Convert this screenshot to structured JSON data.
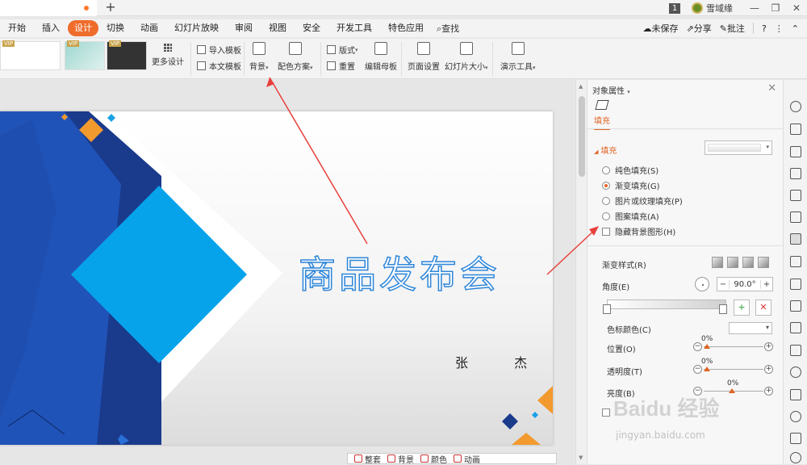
{
  "topbar": {
    "badge": "1",
    "username": "雪域缘"
  },
  "menu": {
    "tabs": [
      "开始",
      "插入",
      "设计",
      "切换",
      "动画",
      "幻灯片放映",
      "审阅",
      "视图",
      "安全",
      "开发工具",
      "特色应用"
    ],
    "active_index": 2,
    "search": "查找",
    "right": [
      "未保存",
      "分享",
      "批注"
    ]
  },
  "ribbon": {
    "more_design": "更多设计",
    "import_template": "导入模板",
    "this_template": "本文模板",
    "background": "背景",
    "color_scheme": "配色方案",
    "layout": "版式",
    "reset": "重置",
    "edit_master": "编辑母板",
    "page_setup": "页面设置",
    "slide_size": "幻灯片大小",
    "presentation_tools": "演示工具",
    "vip": "VIP"
  },
  "slide": {
    "title": "商品发布会",
    "subtitle": "张  杰"
  },
  "bottom_toolbar": [
    "整套",
    "背景",
    "颜色",
    "动画"
  ],
  "panel": {
    "title": "对象属性",
    "tab": "填充",
    "section": "填充",
    "fill_options": [
      {
        "label": "纯色填充(S)",
        "selected": false
      },
      {
        "label": "渐变填充(G)",
        "selected": true
      },
      {
        "label": "图片或纹理填充(P)",
        "selected": false
      },
      {
        "label": "图案填充(A)",
        "selected": false
      }
    ],
    "hide_bg_graphics": "隐藏背景图形(H)",
    "gradient_style": "渐变样式(R)",
    "angle_label": "角度(E)",
    "angle_value": "90.0°",
    "stop_color": "色标颜色(C)",
    "position_label": "位置(O)",
    "position_value": "0%",
    "transparency_label": "透明度(T)",
    "transparency_value": "0%",
    "brightness_label": "亮度(B)",
    "brightness_value": "0%"
  },
  "colors": {
    "accent": "#ef6c2b",
    "title_blue": "#2e86d9",
    "arrow_red": "#e8413c"
  }
}
